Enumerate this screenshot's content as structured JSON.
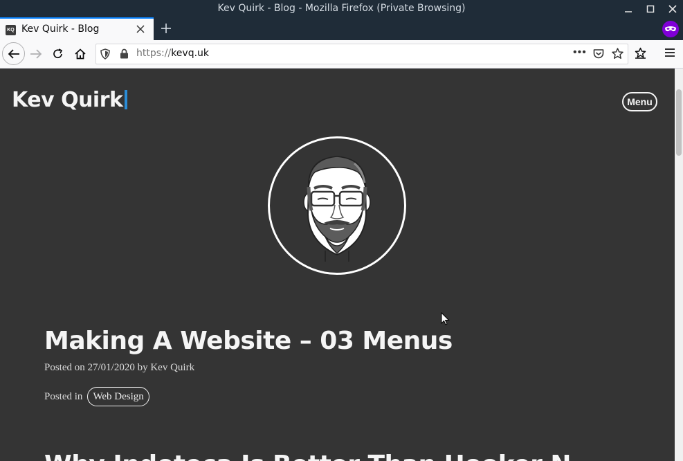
{
  "window": {
    "title": "Kev Quirk - Blog - Mozilla Firefox (Private Browsing)"
  },
  "tab": {
    "favicon_text": "KQ",
    "title": "Kev Quirk - Blog"
  },
  "toolbar": {
    "url_scheme": "https://",
    "url_host": "kevq.uk",
    "more_label": "•••"
  },
  "site": {
    "title": "Kev Quirk",
    "menu_label": "Menu"
  },
  "post": {
    "title": "Making A Website – 03 Menus",
    "meta": "Posted on 27/01/2020 by Kev Quirk",
    "category_prefix": "Posted in",
    "category": "Web Design"
  },
  "next_post": {
    "title_partial": "Why Indoteca Is Better Than Hooker N..."
  },
  "colors": {
    "accent": "#0a84ff",
    "private": "#8000d7",
    "page_bg": "#343434",
    "titlebar_bg": "#1f2c38"
  }
}
